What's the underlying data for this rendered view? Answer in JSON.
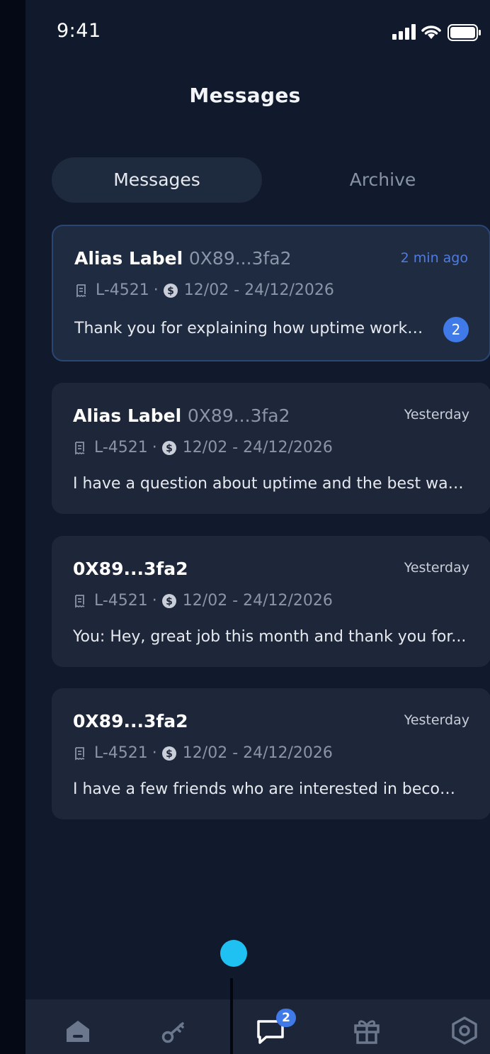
{
  "status_bar": {
    "time": "9:41"
  },
  "header": {
    "title": "Messages"
  },
  "tabs": [
    {
      "label": "Messages",
      "selected": true
    },
    {
      "label": "Archive",
      "selected": false
    }
  ],
  "conversations": [
    {
      "name": "Alias Label",
      "address": "0X89...3fa2",
      "time": "2 min ago",
      "lease_id": "L-4521",
      "separator": "·",
      "period": "12/02 - 24/12/2026",
      "preview": "Thank you for explaining how uptime works...",
      "unread": "2"
    },
    {
      "name": "Alias Label",
      "address": "0X89...3fa2",
      "time": "Yesterday",
      "lease_id": "L-4521",
      "separator": "·",
      "period": "12/02 - 24/12/2026",
      "preview": "I have a question about uptime and the best way..."
    },
    {
      "name": "0X89...3fa2",
      "time": "Yesterday",
      "lease_id": "L-4521",
      "separator": "·",
      "period": "12/02 - 24/12/2026",
      "preview": "You: Hey, great job this month and thank you for..."
    },
    {
      "name": "0X89...3fa2",
      "time": "Yesterday",
      "lease_id": "L-4521",
      "separator": "·",
      "period": "12/02 - 24/12/2026",
      "preview": "I have a few friends who are interested in becomi..."
    }
  ],
  "bottom_nav": {
    "items": [
      {
        "icon": "home-icon"
      },
      {
        "icon": "key-icon"
      },
      {
        "icon": "chat-icon",
        "active": true,
        "badge": "2"
      },
      {
        "icon": "gift-icon"
      },
      {
        "icon": "settings-hex-icon"
      }
    ]
  },
  "colors": {
    "background": "#111a2c",
    "card": "#1d2739",
    "accent": "#3f7ae8",
    "drag_handle": "#1fc0f2"
  }
}
